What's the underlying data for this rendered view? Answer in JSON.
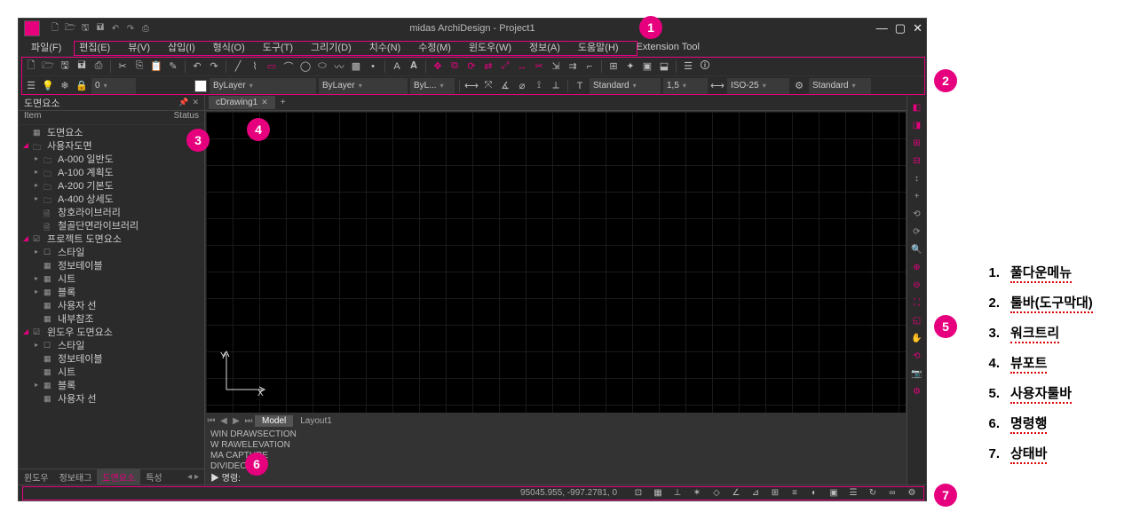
{
  "title_bar": {
    "title": "midas ArchiDesign - Project1",
    "qat_icons": [
      "new-icon",
      "open-icon",
      "save-icon",
      "save-all-icon",
      "undo-icon",
      "redo-icon",
      "print-icon"
    ],
    "win_min": "—",
    "win_max": "▢",
    "win_close": "✕"
  },
  "menu": {
    "items": [
      "파일(F)",
      "편집(E)",
      "뷰(V)",
      "삽입(I)",
      "형식(O)",
      "도구(T)",
      "그리기(D)",
      "치수(N)",
      "수정(M)",
      "윈도우(W)",
      "정보(A)",
      "도움말(H)",
      "Extension Tool"
    ]
  },
  "toolbar1_icons": [
    "new",
    "open",
    "save",
    "saveas",
    "folder",
    "print",
    "cut",
    "copy",
    "paste",
    "clip",
    "undo",
    "redo",
    "|",
    "line",
    "pline",
    "rect",
    "circle",
    "arc",
    "ellipse",
    "spline",
    "hatch",
    "text",
    "|",
    "dim",
    "leader",
    "|",
    "sel1",
    "sel2",
    "sel3",
    "sel4",
    "sel5",
    "sel6",
    "sel7",
    "|",
    "snap1",
    "snap2",
    "snap3",
    "snap4",
    "snap5",
    "snap6",
    "|",
    "grp1",
    "grp2",
    "grp3",
    "grp4"
  ],
  "toolbar2": {
    "layer_swatch": "white",
    "layer_value": "ByLayer",
    "color_value": "ByLayer",
    "lt_value": "ByL...",
    "text_style": "Standard",
    "scale": "1,5",
    "dim_style": "ISO-25",
    "dim_std": "Standard",
    "lineweight": "0",
    "left_icons": [
      "layers",
      "lightbulb",
      "snowflake",
      "lock"
    ]
  },
  "tree": {
    "title": "도면요소",
    "col_item": "Item",
    "col_status": "Status",
    "nodes": [
      {
        "d": 0,
        "tw": "",
        "ic": "▦",
        "label": "도면요소"
      },
      {
        "d": 0,
        "tw": "red",
        "ic": "🗀",
        "label": "사용자도면"
      },
      {
        "d": 1,
        "tw": "▸",
        "ic": "🗀",
        "label": "A-000 일반도"
      },
      {
        "d": 1,
        "tw": "▸",
        "ic": "🗀",
        "label": "A-100 계획도"
      },
      {
        "d": 1,
        "tw": "▸",
        "ic": "🗀",
        "label": "A-200 기본도"
      },
      {
        "d": 1,
        "tw": "▸",
        "ic": "🗀",
        "label": "A-400 상세도"
      },
      {
        "d": 1,
        "tw": "",
        "ic": "🗎",
        "label": "창호라이브러리"
      },
      {
        "d": 1,
        "tw": "",
        "ic": "🗎",
        "label": "철골단면라이브러리"
      },
      {
        "d": 0,
        "tw": "red",
        "ic": "☑",
        "label": "프로젝트 도면요소"
      },
      {
        "d": 1,
        "tw": "▸",
        "ic": "☐",
        "label": "스타일"
      },
      {
        "d": 1,
        "tw": "",
        "ic": "▦",
        "label": "정보테이블"
      },
      {
        "d": 1,
        "tw": "▸",
        "ic": "▦",
        "label": "시트"
      },
      {
        "d": 1,
        "tw": "▸",
        "ic": "▦",
        "label": "블록"
      },
      {
        "d": 1,
        "tw": "",
        "ic": "▦",
        "label": "사용자 선"
      },
      {
        "d": 1,
        "tw": "",
        "ic": "▦",
        "label": "내부참조"
      },
      {
        "d": 0,
        "tw": "red",
        "ic": "☑",
        "label": "윈도우 도면요소"
      },
      {
        "d": 1,
        "tw": "▸",
        "ic": "☐",
        "label": "스타일"
      },
      {
        "d": 1,
        "tw": "",
        "ic": "▦",
        "label": "정보테이블"
      },
      {
        "d": 1,
        "tw": "",
        "ic": "▦",
        "label": "시트"
      },
      {
        "d": 1,
        "tw": "▸",
        "ic": "▦",
        "label": "블록"
      },
      {
        "d": 1,
        "tw": "",
        "ic": "▦",
        "label": "사용자 선"
      }
    ],
    "tabs": [
      "윈도우",
      "정보태그",
      "도면요소",
      "특성"
    ],
    "active_tab": 2
  },
  "doc": {
    "tab": "cDrawing1",
    "plus": "+"
  },
  "axis": {
    "y": "Y",
    "x": "X"
  },
  "model_tabs": {
    "tabs": [
      "Model",
      "Layout1"
    ],
    "active": 0
  },
  "cmd": {
    "history": [
      "WIN       DRAWSECTION",
      "W          RAWELEVATION",
      "MA         CAPTURE",
      "DIVIDECOPY"
    ],
    "prompt": "▶ 명령:"
  },
  "right_icons": [
    "a",
    "b",
    "c",
    "d",
    "e",
    "f",
    "g",
    "h",
    "i",
    "j",
    "k",
    "l",
    "m",
    "n",
    "o",
    "p",
    "q"
  ],
  "status": {
    "coords": "95045.955, -997.2781, 0",
    "icons": [
      "snap",
      "grid",
      "ortho",
      "polar",
      "osnap",
      "otrack",
      "ducs",
      "dyn",
      "lwt",
      "tp",
      "qs",
      "sel",
      "cyc",
      "ann",
      "|",
      "wkspc"
    ]
  },
  "callouts": {
    "1": "1",
    "2": "2",
    "3": "3",
    "4": "4",
    "5": "5",
    "6": "6",
    "7": "7"
  },
  "legend": [
    {
      "n": "1.",
      "t": "풀다운메뉴"
    },
    {
      "n": "2.",
      "t": "툴바(도구막대)"
    },
    {
      "n": "3.",
      "t": "워크트리"
    },
    {
      "n": "4.",
      "t": "뷰포트"
    },
    {
      "n": "5.",
      "t": "사용자툴바"
    },
    {
      "n": "6.",
      "t": "명령행"
    },
    {
      "n": "7.",
      "t": "상태바"
    }
  ]
}
